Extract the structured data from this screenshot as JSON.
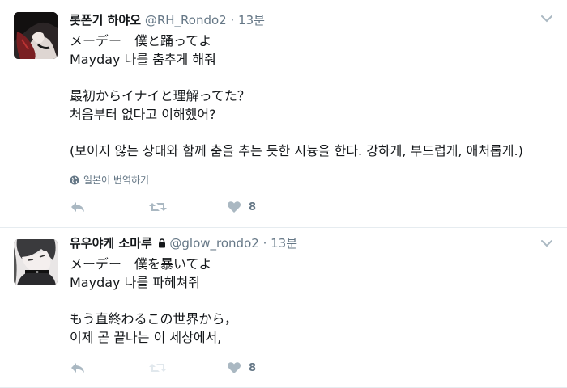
{
  "tweets": [
    {
      "name": "롯폰기 하야오",
      "handle": "@RH_Rondo2",
      "dot": "·",
      "time": "13분",
      "protected": false,
      "lines": [
        "メーデー　僕と踊ってよ",
        "Mayday 나를 춤추게 해줘",
        "",
        "最初からイナイと理解ってた？",
        "처음부터 없다고 이해했어?",
        "",
        "(보이지 않는 상대와 함께 춤을 추는 듯한 시늉을 한다. 강하게, 부드럽게, 애처롭게.)"
      ],
      "translate_label": "일본어 번역하기",
      "like_count": "8",
      "avatar_icon": "user-avatar-dark"
    },
    {
      "name": "유우야케 소마루",
      "handle": "@glow_rondo2",
      "dot": "·",
      "time": "13분",
      "protected": true,
      "lines": [
        "メーデー　僕を暴いてよ",
        "Mayday 나를 파헤쳐줘",
        "",
        "もう直終わるこの世界から，",
        "이제 곧 끝나는 이 세상에서,"
      ],
      "like_count": "8",
      "avatar_icon": "user-avatar-collar"
    }
  ],
  "icons": {
    "reply": "reply-icon",
    "retweet": "retweet-icon",
    "like": "heart-icon",
    "more": "chevron-down-icon",
    "globe": "globe-icon",
    "lock": "lock-icon"
  },
  "colors": {
    "text": "#14171a",
    "muted": "#657786",
    "icon": "#aab8c2",
    "divider": "#e6ecf0"
  }
}
